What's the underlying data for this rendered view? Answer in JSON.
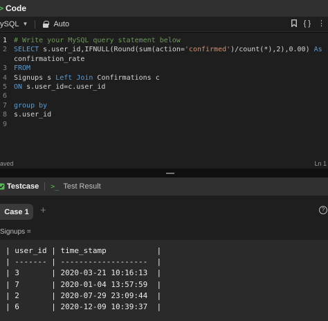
{
  "code_panel": {
    "title": "Code",
    "language": "ySQL",
    "mode": "Auto",
    "icon_bookmark": "bookmark-icon",
    "icon_braces": "{ }",
    "icon_more": "⋮"
  },
  "editor": {
    "lines": [
      {
        "n": "1",
        "parts": [
          {
            "t": "# Write your MySQL query statement below",
            "c": "cmt"
          }
        ]
      },
      {
        "n": "2",
        "parts": [
          {
            "t": "SELECT ",
            "c": "kw"
          },
          {
            "t": "s.user_id,",
            "c": ""
          },
          {
            "t": "IFNULL",
            "c": ""
          },
          {
            "t": "(",
            "c": ""
          },
          {
            "t": "Round",
            "c": ""
          },
          {
            "t": "(",
            "c": ""
          },
          {
            "t": "sum",
            "c": ""
          },
          {
            "t": "(action=",
            "c": ""
          },
          {
            "t": "'confirmed'",
            "c": "str"
          },
          {
            "t": ")/",
            "c": ""
          },
          {
            "t": "count",
            "c": ""
          },
          {
            "t": "(*),",
            "c": ""
          },
          {
            "t": "2",
            "c": ""
          },
          {
            "t": "),",
            "c": ""
          },
          {
            "t": "0.00",
            "c": ""
          },
          {
            "t": ") ",
            "c": ""
          },
          {
            "t": "As",
            "c": "kw"
          }
        ]
      },
      {
        "n": "",
        "parts": [
          {
            "t": "confirmation_rate",
            "c": ""
          }
        ]
      },
      {
        "n": "3",
        "parts": [
          {
            "t": "FROM",
            "c": "kw"
          }
        ]
      },
      {
        "n": "4",
        "parts": [
          {
            "t": "Signups s ",
            "c": ""
          },
          {
            "t": "Left Join",
            "c": "kw"
          },
          {
            "t": " Confirmations c",
            "c": ""
          }
        ]
      },
      {
        "n": "5",
        "parts": [
          {
            "t": "ON",
            "c": "kw"
          },
          {
            "t": " s.user_id=c.user_id",
            "c": ""
          }
        ]
      },
      {
        "n": "6",
        "parts": []
      },
      {
        "n": "7",
        "parts": [
          {
            "t": "group by",
            "c": "kw"
          }
        ]
      },
      {
        "n": "8",
        "parts": [
          {
            "t": "s.user_id",
            "c": ""
          }
        ]
      },
      {
        "n": "9",
        "parts": []
      }
    ],
    "status_saved": "aved",
    "status_position": "Ln 1"
  },
  "bottom_panel": {
    "tab_testcase": "Testcase",
    "tab_result": "Test Result",
    "case_label": "Case 1",
    "add_symbol": "+",
    "help_symbol": "?",
    "table_label": "Signups ="
  },
  "signups_table": {
    "columns": [
      "user_id",
      "time_stamp"
    ],
    "rows": [
      [
        "3",
        "2020-03-21 10:16:13"
      ],
      [
        "7",
        "2020-01-04 13:57:59"
      ],
      [
        "2",
        "2020-07-29 23:09:44"
      ],
      [
        "6",
        "2020-12-09 10:39:37"
      ]
    ]
  },
  "colors": {
    "accent_green": "#57b659",
    "keyword": "#569cd6",
    "string": "#ce9178",
    "comment": "#6a9955"
  }
}
